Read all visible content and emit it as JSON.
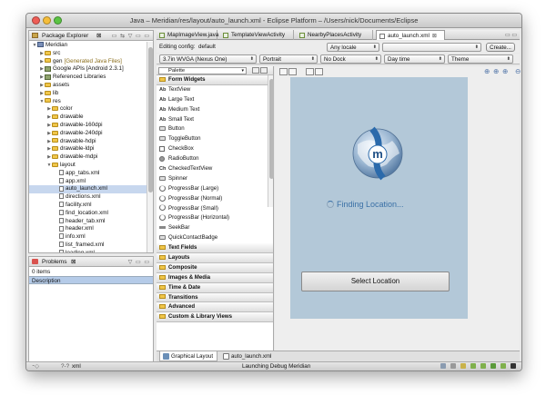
{
  "window": {
    "title": "Java – Meridian/res/layout/auto_launch.xml - Eclipse Platform – /Users/nick/Documents/Eclipse",
    "traffic_colors": [
      "#ee5d56",
      "#f5bd3a",
      "#5bc443"
    ]
  },
  "package_explorer": {
    "tab_label": "Package Explorer",
    "tab_close": "⊠",
    "tree": [
      {
        "label": "Meridian",
        "icon": "project-icon",
        "twisty": "▼",
        "indent": 0
      },
      {
        "label": "src",
        "icon": "folder-icon",
        "twisty": "▶",
        "indent": 1
      },
      {
        "label": "gen",
        "suffix": "[Generated Java Files]",
        "icon": "folder-icon",
        "twisty": "▶",
        "indent": 1
      },
      {
        "label": "Google APIs [Android 2.3.1]",
        "icon": "library-icon",
        "twisty": "▶",
        "indent": 1
      },
      {
        "label": "Referenced Libraries",
        "icon": "library-icon",
        "twisty": "▶",
        "indent": 1
      },
      {
        "label": "assets",
        "icon": "folder-icon",
        "twisty": "▶",
        "indent": 1
      },
      {
        "label": "lib",
        "icon": "folder-icon",
        "twisty": "▶",
        "indent": 1
      },
      {
        "label": "res",
        "icon": "folder-icon",
        "twisty": "▼",
        "indent": 1
      },
      {
        "label": "color",
        "icon": "folder-icon",
        "twisty": "▶",
        "indent": 2
      },
      {
        "label": "drawable",
        "icon": "folder-icon",
        "twisty": "▶",
        "indent": 2
      },
      {
        "label": "drawable-160dpi",
        "icon": "folder-icon",
        "twisty": "▶",
        "indent": 2
      },
      {
        "label": "drawable-240dpi",
        "icon": "folder-icon",
        "twisty": "▶",
        "indent": 2
      },
      {
        "label": "drawable-hdpi",
        "icon": "folder-icon",
        "twisty": "▶",
        "indent": 2
      },
      {
        "label": "drawable-ldpi",
        "icon": "folder-icon",
        "twisty": "▶",
        "indent": 2
      },
      {
        "label": "drawable-mdpi",
        "icon": "folder-icon",
        "twisty": "▶",
        "indent": 2
      },
      {
        "label": "layout",
        "icon": "folder-icon",
        "twisty": "▼",
        "indent": 2
      },
      {
        "label": "app_tabs.xml",
        "icon": "xml-file-icon",
        "twisty": "",
        "indent": 3
      },
      {
        "label": "app.xml",
        "icon": "xml-file-icon",
        "twisty": "",
        "indent": 3
      },
      {
        "label": "auto_launch.xml",
        "icon": "xml-file-icon",
        "twisty": "",
        "indent": 3,
        "selected": true
      },
      {
        "label": "directions.xml",
        "icon": "xml-file-icon",
        "twisty": "",
        "indent": 3
      },
      {
        "label": "facility.xml",
        "icon": "xml-file-icon",
        "twisty": "",
        "indent": 3
      },
      {
        "label": "find_location.xml",
        "icon": "xml-file-icon",
        "twisty": "",
        "indent": 3
      },
      {
        "label": "header_tab.xml",
        "icon": "xml-file-icon",
        "twisty": "",
        "indent": 3
      },
      {
        "label": "header.xml",
        "icon": "xml-file-icon",
        "twisty": "",
        "indent": 3
      },
      {
        "label": "info.xml",
        "icon": "xml-file-icon",
        "twisty": "",
        "indent": 3
      },
      {
        "label": "list_framed.xml",
        "icon": "xml-file-icon",
        "twisty": "",
        "indent": 3
      },
      {
        "label": "loading.xml",
        "icon": "xml-file-icon",
        "twisty": "",
        "indent": 3
      }
    ]
  },
  "problems": {
    "tab_label": "Problems",
    "tab_close": "⊠",
    "count": "0 items",
    "column": "Description"
  },
  "editor_tabs": [
    {
      "label": "MapImageView.java",
      "type": "java",
      "active": false
    },
    {
      "label": "TemplateViewActivity",
      "type": "java",
      "active": false
    },
    {
      "label": "NearbyPlacesActivity",
      "type": "java",
      "active": false
    },
    {
      "label": "auto_launch.xml",
      "type": "xml",
      "active": true,
      "close": "⊠"
    }
  ],
  "config": {
    "editing_label": "Editing config:",
    "editing_value": "default",
    "locale": "Any locale",
    "create_button": "Create...",
    "device": "3.7in WVGA (Nexus One)",
    "orientation": "Portrait",
    "dock": "No Dock",
    "time": "Day time",
    "theme": "Theme"
  },
  "palette": {
    "label": "Palette",
    "categories_top": "Form Widgets",
    "widgets": [
      {
        "label": "TextView",
        "icon": "Ab"
      },
      {
        "label": "Large Text",
        "icon": "Ab"
      },
      {
        "label": "Medium Text",
        "icon": "Ab"
      },
      {
        "label": "Small Text",
        "icon": "Ab"
      },
      {
        "label": "Button",
        "icon": "button"
      },
      {
        "label": "ToggleButton",
        "icon": "button"
      },
      {
        "label": "CheckBox",
        "icon": "checkbox"
      },
      {
        "label": "RadioButton",
        "icon": "radio"
      },
      {
        "label": "CheckedTextView",
        "icon": "Ch"
      },
      {
        "label": "Spinner",
        "icon": "button"
      },
      {
        "label": "ProgressBar (Large)",
        "icon": "ring"
      },
      {
        "label": "ProgressBar (Normal)",
        "icon": "ring"
      },
      {
        "label": "ProgressBar (Small)",
        "icon": "ring"
      },
      {
        "label": "ProgressBar (Horizontal)",
        "icon": "ring"
      },
      {
        "label": "SeekBar",
        "icon": "seek"
      },
      {
        "label": "QuickContactBadge",
        "icon": "button"
      }
    ],
    "categories_bottom": [
      "Text Fields",
      "Layouts",
      "Composite",
      "Images & Media",
      "Time & Date",
      "Transitions",
      "Advanced",
      "Custom & Library Views"
    ]
  },
  "device": {
    "status_text": "Finding Location...",
    "button": "Select Location",
    "logo_letter": "m",
    "screen_color": "#b3c8d8"
  },
  "bottom_tabs": [
    {
      "label": "Graphical Layout",
      "active": true
    },
    {
      "label": "auto_launch.xml",
      "active": false
    }
  ],
  "status_bar": {
    "left": "xml",
    "center": "Launching Debug Meridian"
  }
}
